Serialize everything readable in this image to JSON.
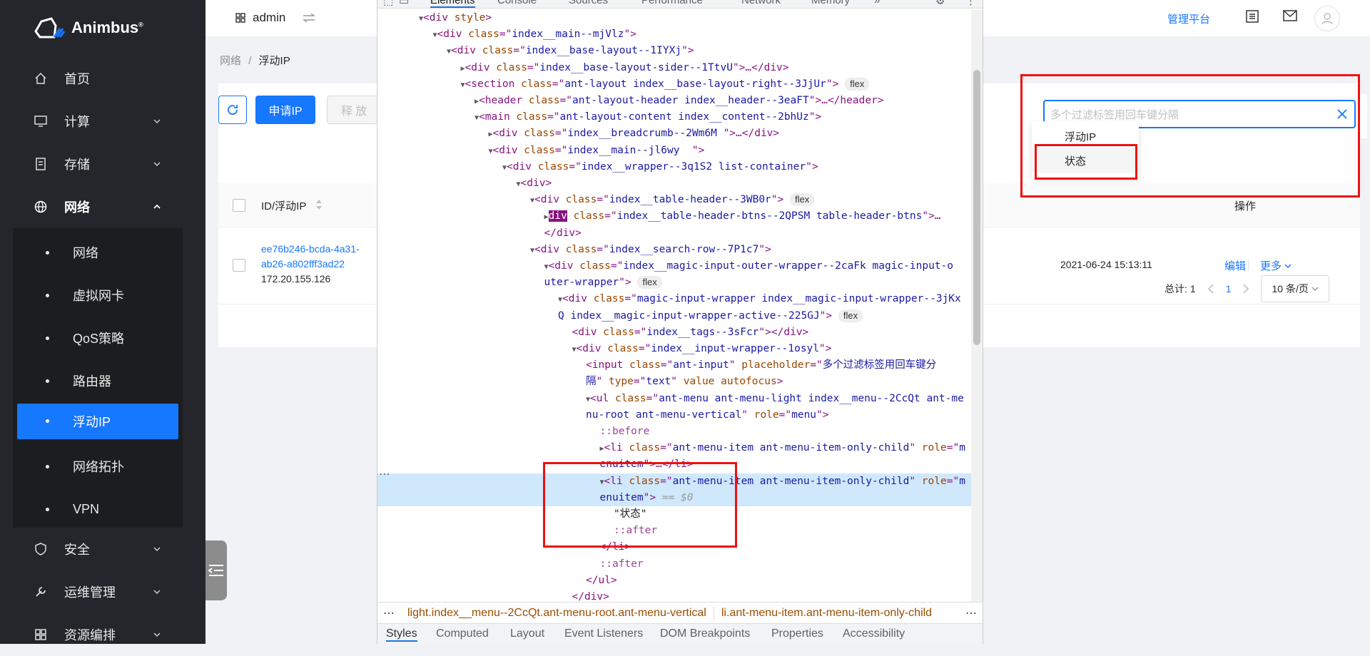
{
  "app": {
    "brand": "Animbus",
    "brand_mark": "®"
  },
  "sidebar": {
    "items": [
      {
        "label": "首页",
        "icon": "home-icon"
      },
      {
        "label": "计算",
        "icon": "monitor-icon"
      },
      {
        "label": "存储",
        "icon": "storage-icon"
      },
      {
        "label": "网络",
        "icon": "globe-icon"
      },
      {
        "label": "安全",
        "icon": "shield-icon"
      },
      {
        "label": "运维管理",
        "icon": "wrench-icon"
      },
      {
        "label": "资源编排",
        "icon": "grid-icon"
      }
    ],
    "network_sub": [
      "网络",
      "虚拟网卡",
      "QoS策略",
      "路由器",
      "浮动IP",
      "网络拓扑",
      "VPN"
    ],
    "active_sub": "浮动IP"
  },
  "topbar": {
    "project": "admin",
    "platform_link": "管理平台"
  },
  "breadcrumb": {
    "parent": "网络",
    "sep": "/",
    "current": "浮动IP"
  },
  "toolbar": {
    "apply_ip": "申请IP",
    "release": "释 放"
  },
  "search": {
    "placeholder": "多个过滤标签用回车键分隔",
    "options": [
      "浮动IP",
      "状态"
    ]
  },
  "table": {
    "columns": {
      "id": "ID/浮动IP",
      "action": "操作"
    },
    "rows": [
      {
        "id_line1": "ee76b246-bcda-4a31-",
        "id_line2": "ab26-a802fff3ad22",
        "ip": "172.20.155.126",
        "created": "2021-06-24 15:13:11",
        "edit": "编辑",
        "more": "更多"
      }
    ]
  },
  "pagination": {
    "total_label": "总计:",
    "total": "1",
    "page": "1",
    "page_size": "10 条/页"
  },
  "devtools": {
    "tabs": [
      "Elements",
      "Console",
      "Sources",
      "Performance",
      "Network",
      "Memory"
    ],
    "code_lines": [
      {
        "indent": 3,
        "html": "<span class='tri'>▼</span><span class='tg'>&lt;div</span> <span class='an'>style</span><span class='tg'>&gt;</span>"
      },
      {
        "indent": 4,
        "html": "<span class='tri'>▼</span><span class='tg'>&lt;div</span> <span class='an'>class</span>=\"<span class='av'>index__main--mjVlz</span>\"<span class='tg'>&gt;</span>"
      },
      {
        "indent": 5,
        "html": "<span class='tri'>▼</span><span class='tg'>&lt;div</span> <span class='an'>class</span>=\"<span class='av'>index__base-layout--1IYXj</span>\"<span class='tg'>&gt;</span>"
      },
      {
        "indent": 6,
        "html": "<span class='tri'>▶</span><span class='tg'>&lt;div</span> <span class='an'>class</span>=\"<span class='av'>index__base-layout-sider--1TtvU</span>\"<span class='tg'>&gt;</span>…<span class='tg'>&lt;/div&gt;</span>"
      },
      {
        "indent": 6,
        "html": "<span class='tri'>▼</span><span class='tg'>&lt;section</span> <span class='an'>class</span>=\"<span class='av'>ant-layout index__base-layout-right--3JjUr</span>\"<span class='tg'>&gt;</span> <span class='pill'>flex</span>"
      },
      {
        "indent": 7,
        "html": "<span class='tri'>▶</span><span class='tg'>&lt;header</span> <span class='an'>class</span>=\"<span class='av'>ant-layout-header index__header--3eaFT</span>\"<span class='tg'>&gt;</span>…<span class='tg'>&lt;/header&gt;</span>"
      },
      {
        "indent": 7,
        "html": "<span class='tri'>▼</span><span class='tg'>&lt;main</span> <span class='an'>class</span>=\"<span class='av'>ant-layout-content index__content--2bhUz</span>\"<span class='tg'>&gt;</span>"
      },
      {
        "indent": 8,
        "html": "<span class='tri'>▶</span><span class='tg'>&lt;div</span> <span class='an'>class</span>=\"<span class='av'>index__breadcrumb--2Wm6M </span>\"<span class='tg'>&gt;</span>…<span class='tg'>&lt;/div&gt;</span>"
      },
      {
        "indent": 8,
        "html": "<span class='tri'>▼</span><span class='tg'>&lt;div</span> <span class='an'>class</span>=\"<span class='av'>index__main--jl6wy  </span>\"<span class='tg'>&gt;</span>"
      },
      {
        "indent": 9,
        "html": "<span class='tri'>▼</span><span class='tg'>&lt;div</span> <span class='an'>class</span>=\"<span class='av'>index__wrapper--3q1S2 list-container</span>\"<span class='tg'>&gt;</span>"
      },
      {
        "indent": 10,
        "html": "<span class='tri'>▼</span><span class='tg'>&lt;div&gt;</span>"
      },
      {
        "indent": 11,
        "html": "<span class='tri'>▼</span><span class='tg'>&lt;div</span> <span class='an'>class</span>=\"<span class='av'>index__table-header--3WB0r</span>\"<span class='tg'>&gt;</span> <span class='pill'>flex</span>"
      },
      {
        "indent": 12,
        "html": "<span class='tri'>▶</span><span class='hl'>div</span> <span class='an'>class</span>=\"<span class='av'>index__table-header-btns--2QPSM table-header-btns</span>\"<span class='tg'>&gt;</span>…"
      },
      {
        "indent": 12,
        "html": "<span class='tg'>&lt;/div&gt;</span>"
      },
      {
        "indent": 11,
        "html": "<span class='tri'>▼</span><span class='tg'>&lt;div</span> <span class='an'>class</span>=\"<span class='av'>index__search-row--7P1c7</span>\"<span class='tg'>&gt;</span>"
      },
      {
        "indent": 12,
        "html": "<span class='tri'>▼</span><span class='tg'>&lt;div</span> <span class='an'>class</span>=\"<span class='av'>index__magic-input-outer-wrapper--2caFk magic-input-o</span>"
      },
      {
        "indent": 12,
        "html": "<span class='av'>uter-wrapper</span>\"<span class='tg'>&gt;</span> <span class='pill'>flex</span>"
      },
      {
        "indent": 13,
        "html": "<span class='tri'>▼</span><span class='tg'>&lt;div</span> <span class='an'>class</span>=\"<span class='av'>magic-input-wrapper index__magic-input-wrapper--3jKx</span>"
      },
      {
        "indent": 13,
        "html": "<span class='av'>Q index__magic-input-wrapper-active--225GJ</span>\"<span class='tg'>&gt;</span> <span class='pill'>flex</span>"
      },
      {
        "indent": 14,
        "html": "<span class='tg'>&lt;div</span> <span class='an'>class</span>=\"<span class='av'>index__tags--3sFcr</span>\"<span class='tg'>&gt;&lt;/div&gt;</span>"
      },
      {
        "indent": 14,
        "html": "<span class='tri'>▼</span><span class='tg'>&lt;div</span> <span class='an'>class</span>=\"<span class='av'>index__input-wrapper--1osyl</span>\"<span class='tg'>&gt;</span>"
      },
      {
        "indent": 15,
        "html": "<span class='tg'>&lt;input</span> <span class='an'>class</span>=\"<span class='av'>ant-input</span>\" <span class='an'>placeholder</span>=\"<span class='av'>多个过滤标签用回车键分</span>"
      },
      {
        "indent": 15,
        "html": "<span class='av'>隔</span>\" <span class='an'>type</span>=\"<span class='av'>text</span>\" <span class='an'>value autofocus</span><span class='tg'>&gt;</span>"
      },
      {
        "indent": 15,
        "html": "<span class='tri'>▼</span><span class='tg'>&lt;ul</span> <span class='an'>class</span>=\"<span class='av'>ant-menu ant-menu-light index__menu--2CcQt ant-me</span>"
      },
      {
        "indent": 15,
        "html": "<span class='av'>nu-root ant-menu-vertical</span>\" <span class='an'>role</span>=\"<span class='av'>menu</span>\"<span class='tg'>&gt;</span>"
      },
      {
        "indent": 16,
        "html": "<span class='ps'>::before</span>"
      },
      {
        "indent": 16,
        "html": "<span class='tri'>▶</span><span class='tg'>&lt;li</span> <span class='an'>class</span>=\"<span class='av'>ant-menu-item ant-menu-item-only-child</span>\" <span class='an'>role</span>=\"<span class='av'>m</span>"
      },
      {
        "indent": 16,
        "html": "<span class='av'>enuitem</span>\"<span class='tg'>&gt;</span>…<span class='tg'>&lt;/li&gt;</span>"
      },
      {
        "indent": 16,
        "sel": true,
        "html": "<span class='tri'>▼</span><span class='tg'>&lt;li</span> <span class='an'>class</span>=\"<span class='av'>ant-menu-item ant-menu-item-only-child</span>\" <span class='an'>role</span>=\"<span class='av'>m</span>"
      },
      {
        "indent": 16,
        "sel": true,
        "html": "<span class='av'>enuitem</span>\"<span class='tg'>&gt;</span> <span class='cm'>== $0</span>"
      },
      {
        "indent": 17,
        "html": "<span class='tx'>\"状态\"</span>"
      },
      {
        "indent": 17,
        "html": "<span class='ps'>::after</span>"
      },
      {
        "indent": 16,
        "html": "<span class='tg'>&lt;/li&gt;</span>"
      },
      {
        "indent": 16,
        "html": "<span class='ps'>::after</span>"
      },
      {
        "indent": 15,
        "html": "<span class='tg'>&lt;/ul&gt;</span>"
      },
      {
        "indent": 14,
        "html": "<span class='tg'>&lt;/div&gt;</span>"
      }
    ],
    "crumb_left": "light.index__menu--2CcQt.ant-menu-root.ant-menu-vertical",
    "crumb_right": "li.ant-menu-item.ant-menu-item-only-child",
    "bottom_tabs": [
      "Styles",
      "Computed",
      "Layout",
      "Event Listeners",
      "DOM Breakpoints",
      "Properties",
      "Accessibility"
    ]
  }
}
